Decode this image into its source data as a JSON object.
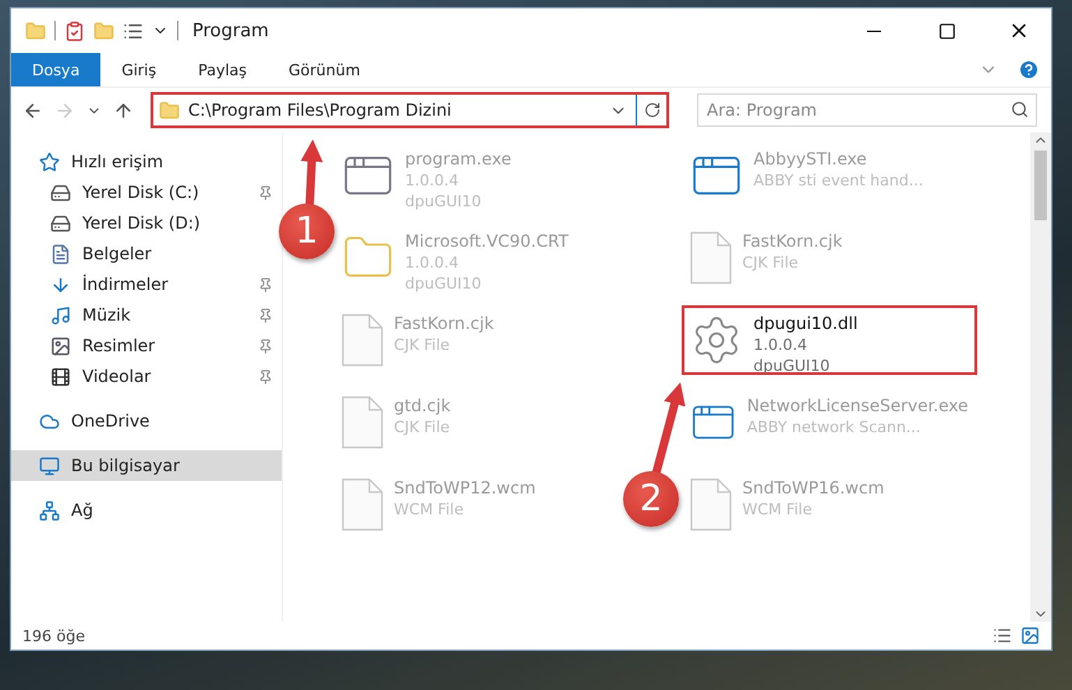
{
  "window": {
    "title": "Program"
  },
  "ribbon_tabs": [
    {
      "label": "Dosya",
      "selected": true
    },
    {
      "label": "Giriş",
      "selected": false
    },
    {
      "label": "Paylaş",
      "selected": false
    },
    {
      "label": "Görünüm",
      "selected": false
    }
  ],
  "address_bar": {
    "path": "C:\\Program Files\\Program Dizini",
    "highlighted": true
  },
  "search": {
    "placeholder": "Ara: Program"
  },
  "sidebar": {
    "items": [
      {
        "label": "Hızlı erişim",
        "kind": "star",
        "selected": false,
        "children": [
          {
            "label": "Yerel Disk (C:)",
            "kind": "disk-c",
            "pinned": true,
            "selected": false
          },
          {
            "label": "Yerel Disk (D:)",
            "kind": "disk",
            "pinned": false,
            "selected": false
          },
          {
            "label": "Belgeler",
            "kind": "docs",
            "pinned": false,
            "selected": false
          },
          {
            "label": "İndirmeler",
            "kind": "download",
            "pinned": true,
            "selected": false
          },
          {
            "label": "Müzik",
            "kind": "music",
            "pinned": true,
            "selected": false
          },
          {
            "label": "Resimler",
            "kind": "pictures",
            "pinned": true,
            "selected": false
          },
          {
            "label": "Videolar",
            "kind": "videos",
            "pinned": true,
            "selected": false
          }
        ]
      },
      {
        "label": "OneDrive",
        "kind": "cloud",
        "selected": false
      },
      {
        "label": "Bu bilgisayar",
        "kind": "pc",
        "selected": true
      },
      {
        "label": "Ağ",
        "kind": "network",
        "selected": false
      }
    ]
  },
  "files": [
    {
      "name": "program.exe",
      "lines": [
        "1.0.0.4",
        "dpuGUI10"
      ],
      "kind": "app",
      "highlighted": false
    },
    {
      "name": "AbbyySTI.exe",
      "lines": [
        "ABBY sti event hand..."
      ],
      "kind": "window",
      "highlighted": false
    },
    {
      "name": "Microsoft.VC90.CRT",
      "lines": [
        "1.0.0.4",
        "dpuGUI10"
      ],
      "kind": "folder",
      "highlighted": false
    },
    {
      "name": "FastKorn.cjk",
      "lines": [
        "CJK File"
      ],
      "kind": "file",
      "highlighted": false
    },
    {
      "name": "FastKorn.cjk",
      "lines": [
        "CJK File"
      ],
      "kind": "file",
      "highlighted": false
    },
    {
      "name": "dpugui10.dll",
      "lines": [
        "1.0.0.4",
        "dpuGUI10"
      ],
      "kind": "gear",
      "highlighted": true
    },
    {
      "name": "gtd.cjk",
      "lines": [
        "CJK File"
      ],
      "kind": "file",
      "highlighted": false
    },
    {
      "name": "NetworkLicenseServer.exe",
      "lines": [
        "ABBY network Scann..."
      ],
      "kind": "window",
      "highlighted": false
    },
    {
      "name": "SndToWP12.wcm",
      "lines": [
        "WCM File"
      ],
      "kind": "file",
      "highlighted": false
    },
    {
      "name": "SndToWP16.wcm",
      "lines": [
        "WCM File"
      ],
      "kind": "file",
      "highlighted": false
    }
  ],
  "annotations": [
    {
      "number": "1"
    },
    {
      "number": "2"
    }
  ],
  "status_bar": {
    "count": "196 öğe"
  }
}
